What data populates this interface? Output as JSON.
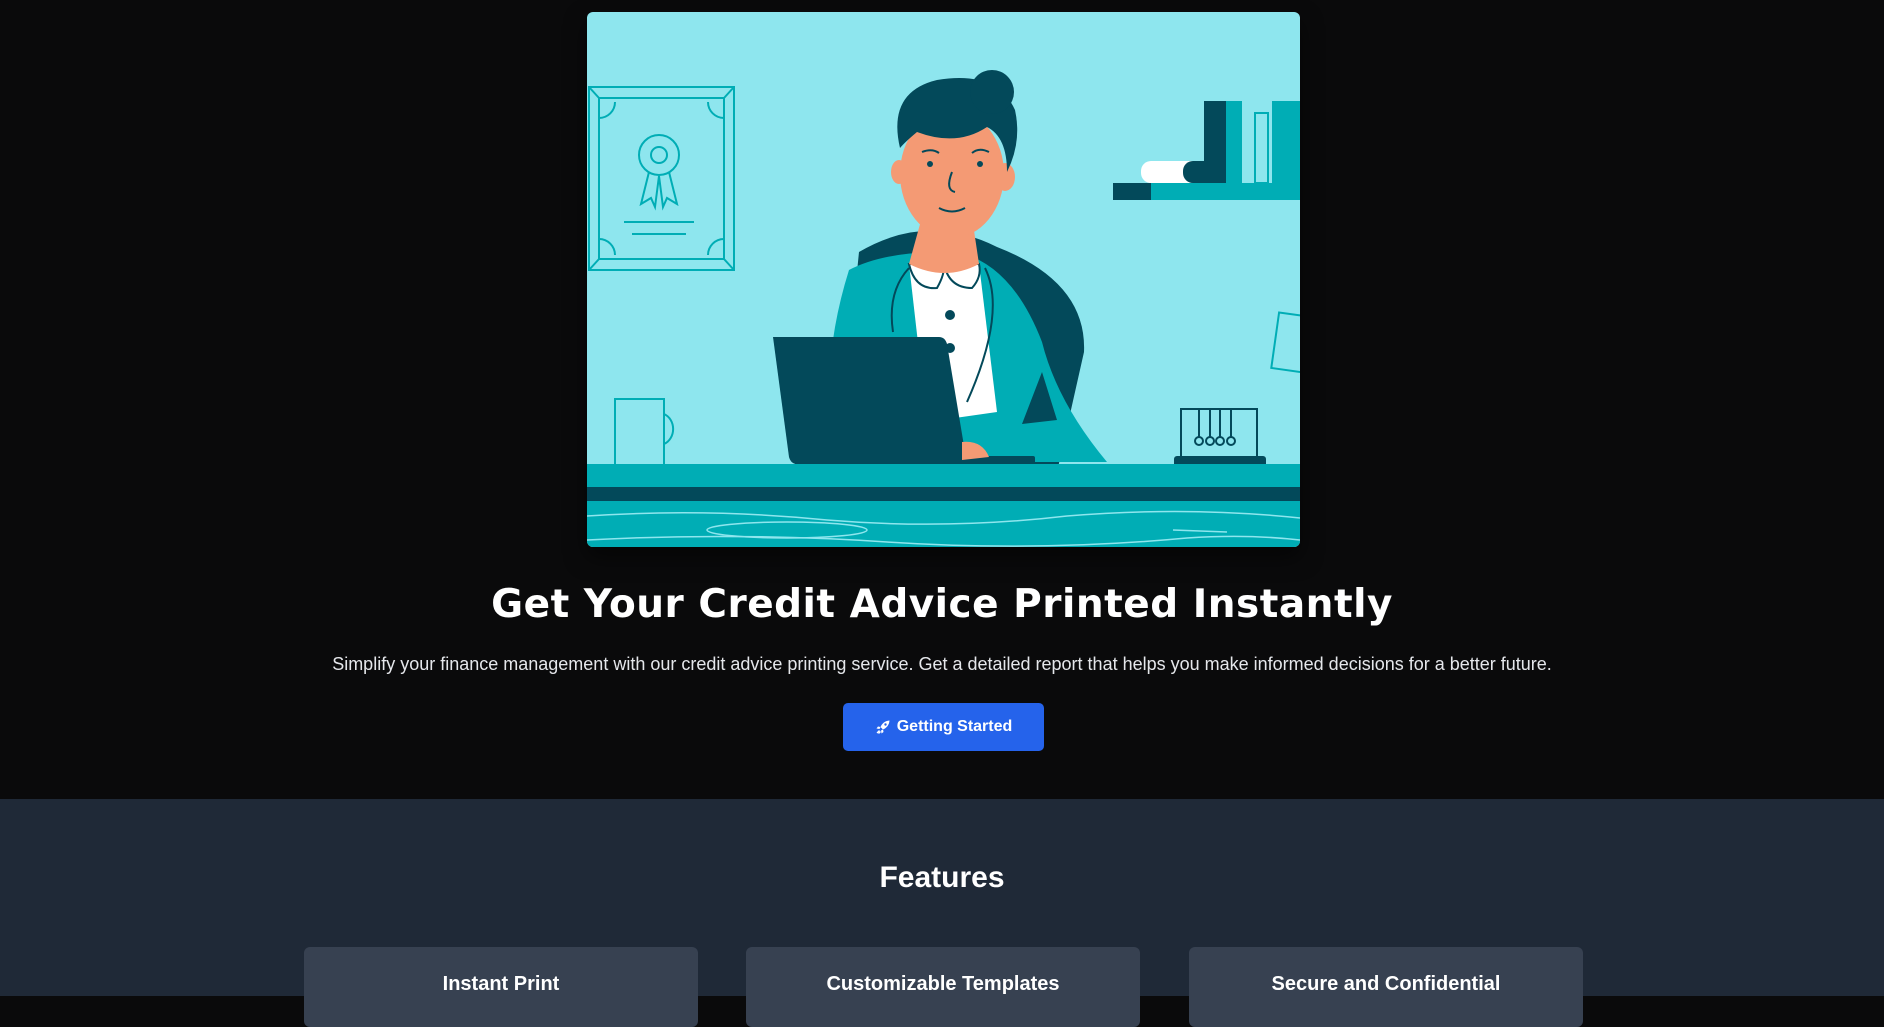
{
  "hero": {
    "illustration_icon": "woman-at-desk-illustration",
    "title": "Get Your Credit Advice Printed Instantly",
    "subtitle": "Simplify your finance management with our credit advice printing service. Get a detailed report that helps you make informed decisions for a better future.",
    "cta": {
      "icon": "rocket-icon",
      "label": "Getting Started"
    }
  },
  "features": {
    "title": "Features",
    "cards": [
      {
        "title": "Instant Print"
      },
      {
        "title": "Customizable Templates"
      },
      {
        "title": "Secure and Confidential"
      }
    ]
  },
  "colors": {
    "page_bg": "#0a0a0b",
    "features_bg": "#1f2937",
    "card_bg": "#374151",
    "accent": "#2563eb",
    "illustration_bg": "#8ee6ee",
    "illustration_teal": "#00adb5",
    "illustration_dark": "#03495a"
  }
}
